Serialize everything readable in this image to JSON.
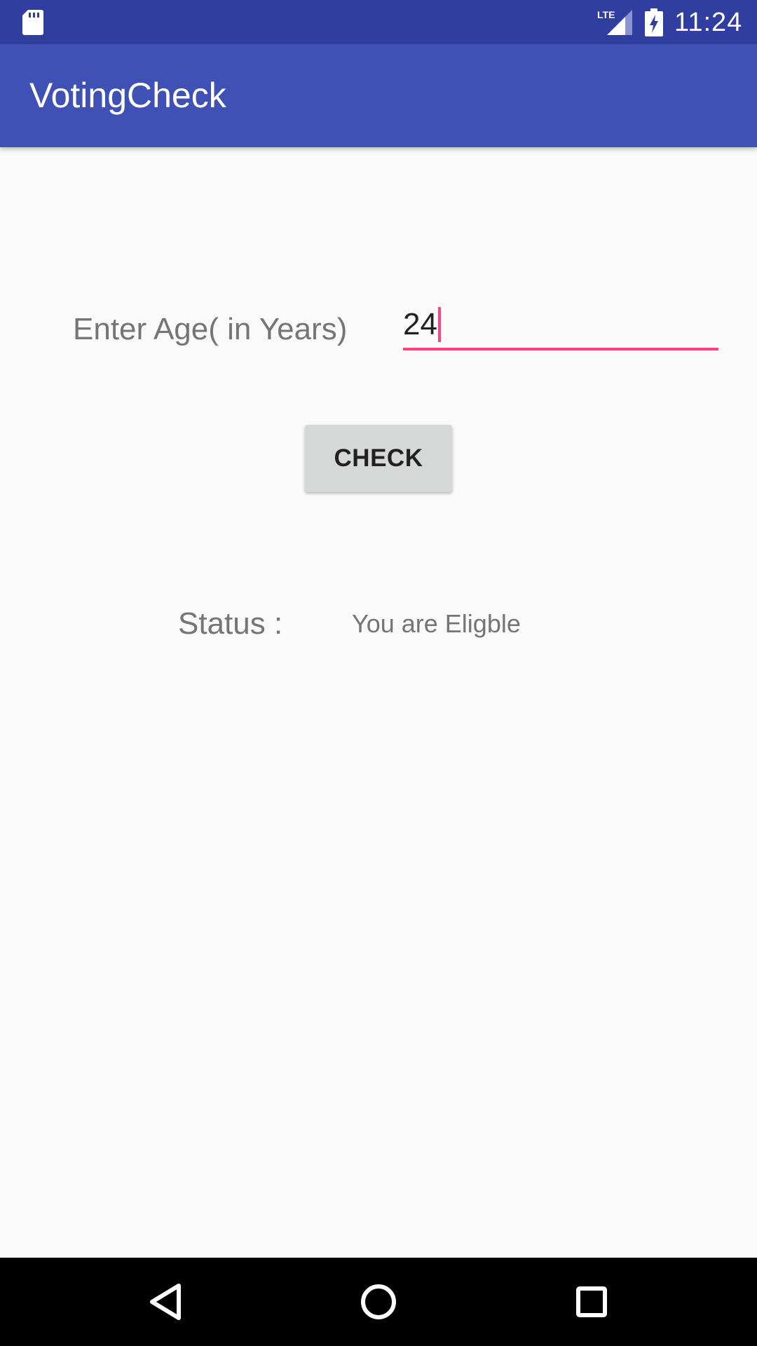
{
  "status_bar": {
    "time": "11:24",
    "network_label": "LTE",
    "icons": [
      "sd-card-icon",
      "lte-signal-icon",
      "battery-charging-icon"
    ]
  },
  "app_bar": {
    "title": "VotingCheck"
  },
  "form": {
    "age_label": "Enter Age( in Years)",
    "age_value": "24",
    "check_button_label": "CHECK"
  },
  "result": {
    "status_label": "Status :",
    "status_value": "You are Eligble"
  },
  "nav_bar": {
    "icons": [
      "back-icon",
      "home-icon",
      "recent-apps-icon"
    ]
  },
  "colors": {
    "status_bar": "#303F9F",
    "app_bar": "#3F51B5",
    "accent": "#FF4081",
    "background": "#FAFAFA",
    "button": "#D6D7D7",
    "secondary_text": "#757575"
  }
}
